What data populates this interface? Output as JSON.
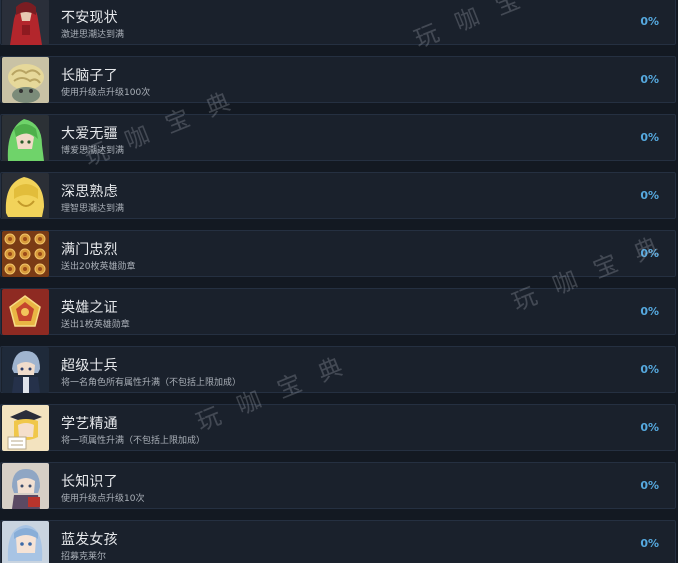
{
  "achievements": [
    {
      "title": "不安现状",
      "desc": "激进思潮达到满",
      "percent": "0%",
      "icon": "red-dress-character-icon"
    },
    {
      "title": "长脑子了",
      "desc": "使用升级点升级100次",
      "percent": "0%",
      "icon": "brain-character-icon"
    },
    {
      "title": "大爱无疆",
      "desc": "博爱思潮达到满",
      "percent": "0%",
      "icon": "green-hair-character-icon"
    },
    {
      "title": "深思熟虑",
      "desc": "理智思潮达到满",
      "percent": "0%",
      "icon": "blonde-hair-character-icon"
    },
    {
      "title": "满门忠烈",
      "desc": "送出20枚英雄勋章",
      "percent": "0%",
      "icon": "medal-pattern-icon"
    },
    {
      "title": "英雄之证",
      "desc": "送出1枚英雄勋章",
      "percent": "0%",
      "icon": "hero-medal-icon"
    },
    {
      "title": "超级士兵",
      "desc": "将一名角色所有属性升满（不包括上限加成）",
      "percent": "0%",
      "icon": "soldier-character-icon"
    },
    {
      "title": "学艺精通",
      "desc": "将一项属性升满（不包括上限加成）",
      "percent": "0%",
      "icon": "graduate-character-icon"
    },
    {
      "title": "长知识了",
      "desc": "使用升级点升级10次",
      "percent": "0%",
      "icon": "book-character-icon"
    },
    {
      "title": "蓝发女孩",
      "desc": "招募克莱尔",
      "percent": "0%",
      "icon": "blue-hair-girl-icon"
    }
  ],
  "watermarks": [
    "玩 咖 宝",
    "玩 咖 宝 典",
    "玩 咖 宝 典",
    "玩 咖 宝 典"
  ]
}
